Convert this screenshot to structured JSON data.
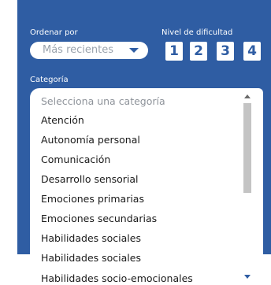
{
  "filters": {
    "sort": {
      "label": "Ordenar por",
      "value": "Más recientes"
    },
    "difficulty": {
      "label": "Nivel de dificultad",
      "levels": [
        "1",
        "2",
        "3",
        "4"
      ]
    },
    "category": {
      "label": "Categoría",
      "placeholder": "Selecciona una categoría",
      "options": [
        "Atención",
        "Autonomía personal",
        "Comunicación",
        "Desarrollo sensorial",
        "Emociones primarias",
        "Emociones secundarias",
        "Habilidades sociales",
        "Habilidades sociales",
        "Habilidades socio-emocionales"
      ]
    }
  },
  "colors": {
    "panel": "#2f5da3",
    "level_text": "#2f5da3",
    "placeholder": "#8e939a"
  }
}
